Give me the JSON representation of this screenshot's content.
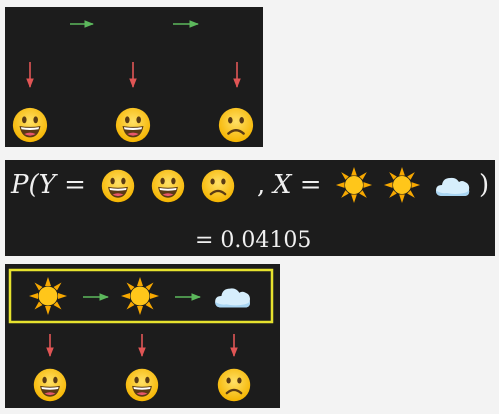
{
  "colors": {
    "background": "#1c1c1c",
    "page": "#f3f3f3",
    "transition_arrow": "#5cb85c",
    "emission_arrow": "#e05555",
    "highlight_box": "#e6e22e",
    "text": "#f0f0f0"
  },
  "top": {
    "observations": [
      "happy-face",
      "happy-face",
      "sad-face"
    ]
  },
  "middle": {
    "prob_prefix": "P(Y =",
    "observations": [
      "happy-face",
      "happy-face",
      "sad-face"
    ],
    "separator": ",",
    "x_label": "X =",
    "states": [
      "sun",
      "sun",
      "cloud"
    ],
    "close_paren": ")",
    "result": "= 0.04105"
  },
  "bottom": {
    "states": [
      "sun",
      "sun",
      "cloud"
    ],
    "observations": [
      "happy-face",
      "happy-face",
      "sad-face"
    ]
  }
}
